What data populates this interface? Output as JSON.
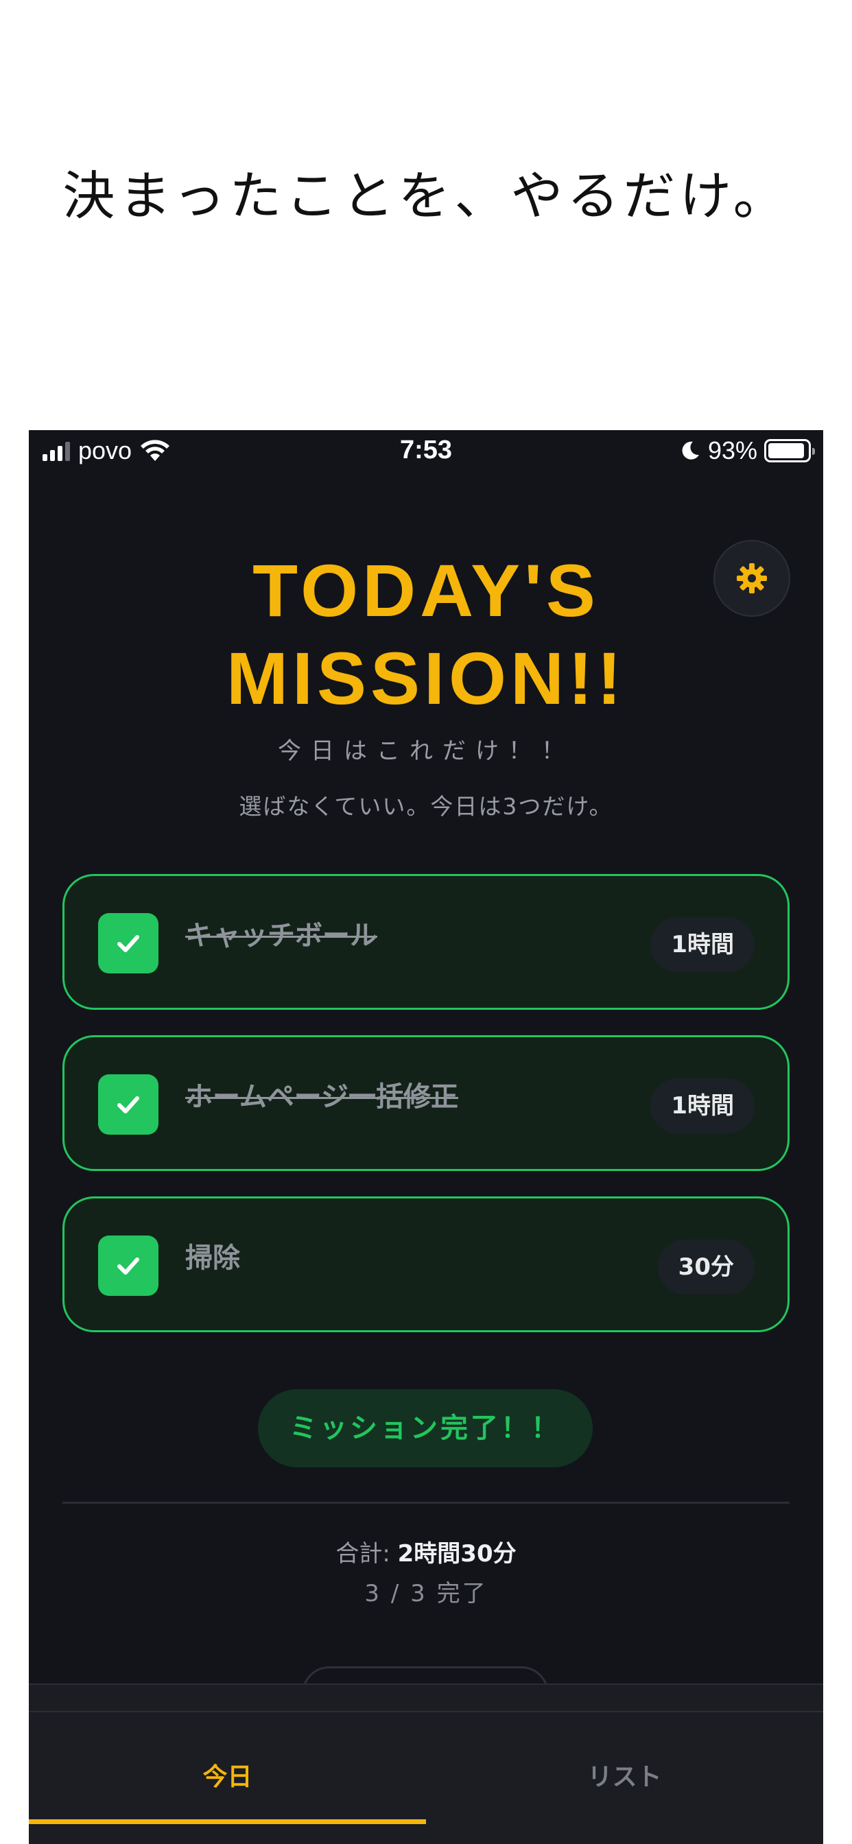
{
  "promo": {
    "headline": "決まったことを、やるだけ。"
  },
  "status_bar": {
    "carrier": "povo",
    "time": "7:53",
    "battery": "93%",
    "battery_level": 0.93
  },
  "header": {
    "title_line1": "TODAY'S",
    "title_line2": "MISSION!!",
    "settings_icon": "gear-icon"
  },
  "subtitle": "今日はこれだけ！！",
  "description": "選ばなくていい。今日は3つだけ。",
  "tasks": [
    {
      "name": "キャッチボール",
      "duration": "1時間",
      "done": true,
      "strikethrough": true
    },
    {
      "name": "ホームページ一括修正",
      "duration": "1時間",
      "done": true,
      "strikethrough": true
    },
    {
      "name": "掃除",
      "duration": "30分",
      "done": true,
      "strikethrough": false
    }
  ],
  "complete_button": "ミッション完了！！",
  "summary": {
    "total_label": "合計:",
    "total_value": "2時間30分",
    "progress": "3 / 3 完了"
  },
  "tab_bar": {
    "tabs": [
      {
        "label": "今日",
        "active": true
      },
      {
        "label": "リスト",
        "active": false
      }
    ]
  },
  "colors": {
    "accent": "#f5b50a",
    "success": "#22c55e",
    "background": "#12141a"
  }
}
